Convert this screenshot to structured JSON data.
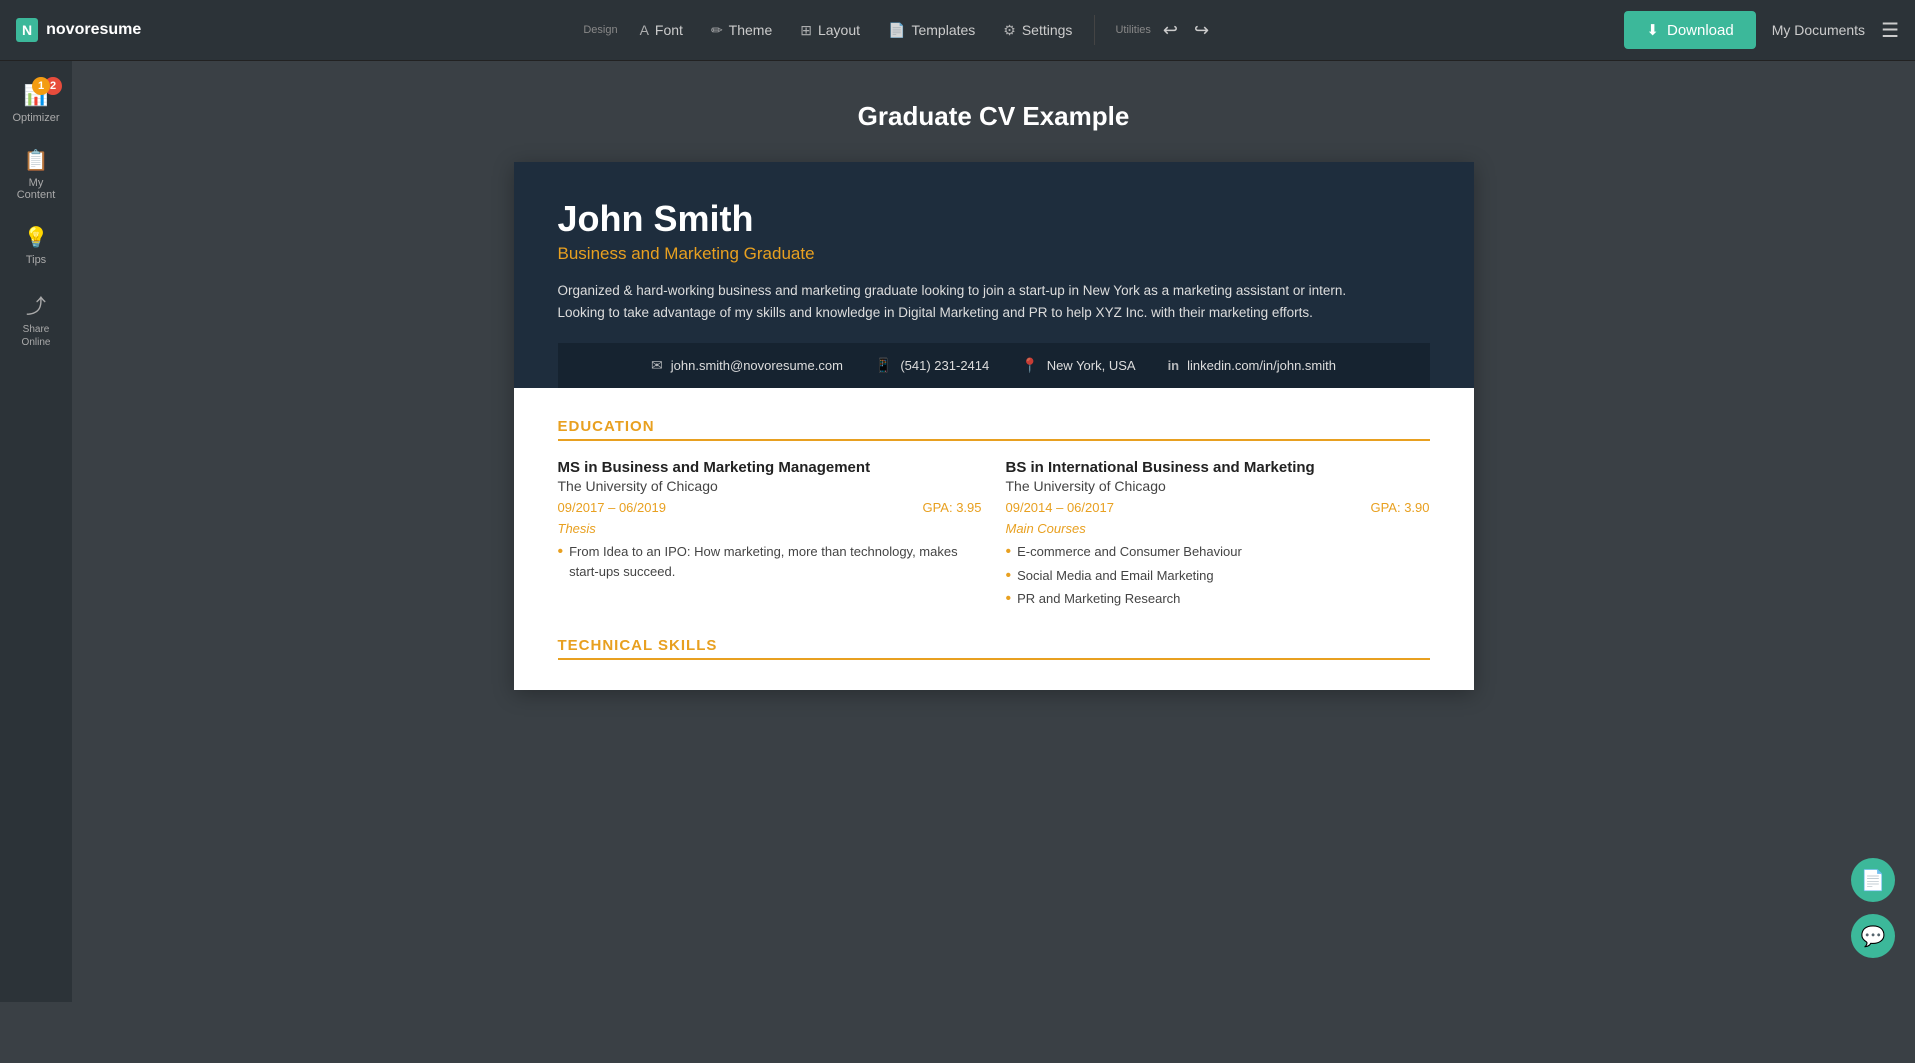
{
  "logo": {
    "box": "N",
    "text": "novoresume"
  },
  "topnav": {
    "design_label": "Design",
    "font_label": "Font",
    "theme_label": "Theme",
    "layout_label": "Layout",
    "templates_label": "Templates",
    "settings_label": "Settings",
    "utilities_label": "Utilities",
    "undo_icon": "↩",
    "redo_icon": "↪",
    "download_label": "Download",
    "my_documents": "My Documents"
  },
  "sidebar": {
    "optimizer_label": "Optimizer",
    "my_content_label": "My Content",
    "tips_label": "Tips",
    "share_online_label": "Share Online",
    "badge_2": "2",
    "badge_1": "1"
  },
  "page": {
    "title": "Graduate CV Example"
  },
  "cv": {
    "name": "John Smith",
    "title": "Business and Marketing Graduate",
    "summary": "Organized & hard-working business and marketing graduate looking to join a start-up in New York as a marketing assistant or intern. Looking to take advantage of my skills and knowledge in Digital Marketing and PR to help XYZ Inc. with their marketing efforts.",
    "contact": {
      "email": "john.smith@novoresume.com",
      "phone": "(541) 231-2414",
      "location": "New York, USA",
      "linkedin": "linkedin.com/in/john.smith"
    },
    "education": {
      "section_title": "EDUCATION",
      "items": [
        {
          "degree": "MS in Business and Marketing Management",
          "school": "The University of Chicago",
          "dates": "09/2017 – 06/2019",
          "gpa": "GPA: 3.95",
          "sub_label": "Thesis",
          "bullets": [
            "From Idea to an IPO: How marketing, more than technology, makes start-ups succeed."
          ]
        },
        {
          "degree": "BS in International Business and Marketing",
          "school": "The University of Chicago",
          "dates": "09/2014 – 06/2017",
          "gpa": "GPA: 3.90",
          "sub_label": "Main Courses",
          "bullets": [
            "E-commerce and Consumer Behaviour",
            "Social Media and Email Marketing",
            "PR and Marketing Research"
          ]
        }
      ]
    },
    "technical_skills": {
      "section_title": "TECHNICAL SKILLS"
    }
  }
}
